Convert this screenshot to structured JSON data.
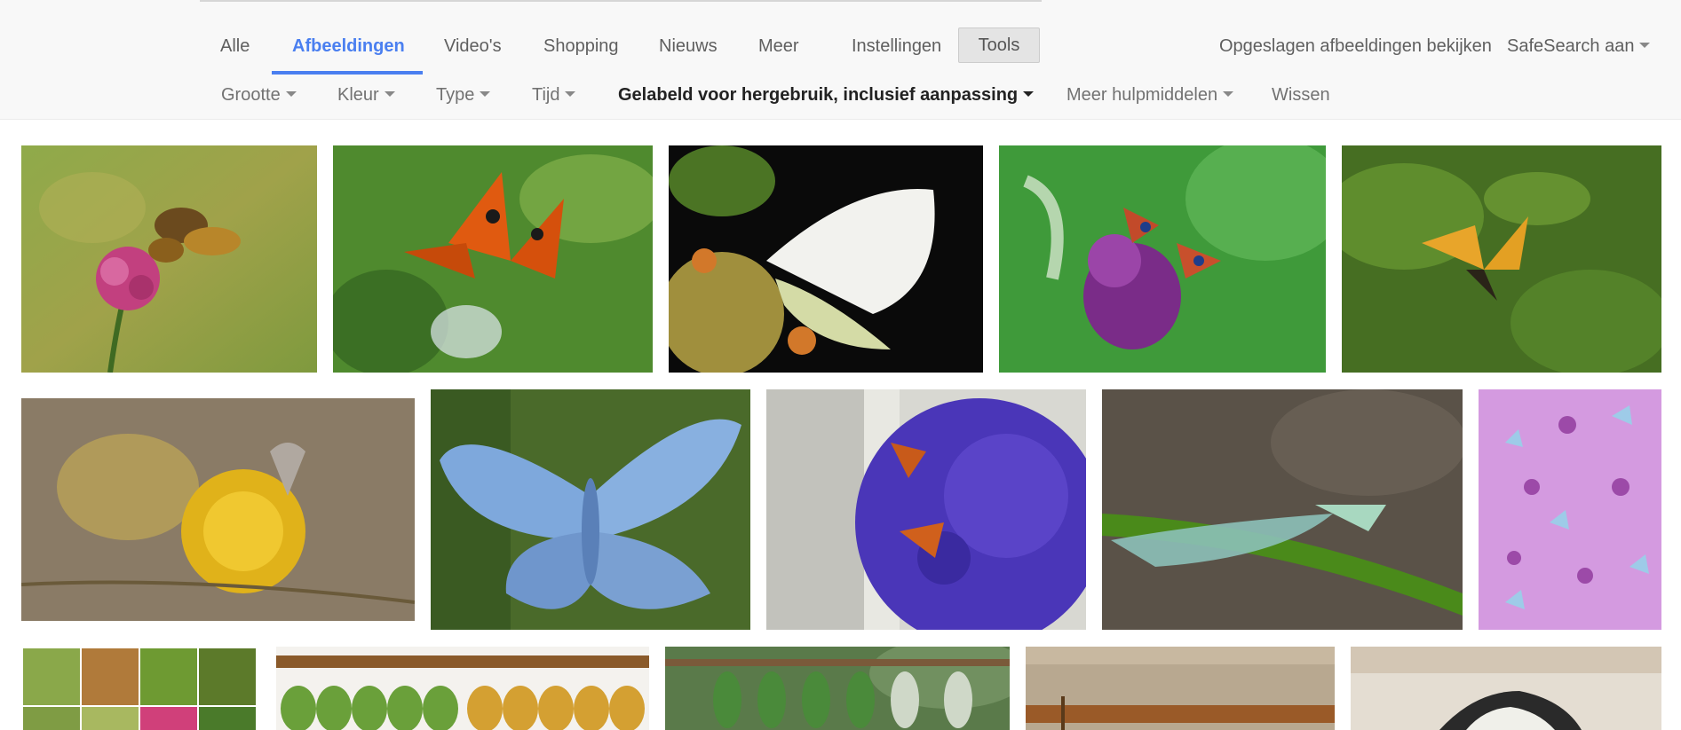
{
  "tabs": [
    {
      "label": "Alle"
    },
    {
      "label": "Afbeeldingen"
    },
    {
      "label": "Video's"
    },
    {
      "label": "Shopping"
    },
    {
      "label": "Nieuws"
    },
    {
      "label": "Meer"
    }
  ],
  "settings_label": "Instellingen",
  "tools_label": "Tools",
  "saved_images_label": "Opgeslagen afbeeldingen bekijken",
  "safesearch_label": "SafeSearch aan",
  "filters": [
    {
      "label": "Grootte"
    },
    {
      "label": "Kleur"
    },
    {
      "label": "Type"
    },
    {
      "label": "Tijd"
    },
    {
      "label": "Gelabeld voor hergebruik, inclusief aanpassing"
    },
    {
      "label": "Meer hulpmiddelen"
    }
  ],
  "clear_label": "Wissen",
  "colors": {
    "accent": "#4a7ff0",
    "header_bg": "#f8f8f8"
  },
  "images": [
    {
      "subject": "skipper butterfly on pink clover"
    },
    {
      "subject": "orange tortoiseshell butterfly"
    },
    {
      "subject": "white cabbage butterfly"
    },
    {
      "subject": "peacock butterflies on buddleja"
    },
    {
      "subject": "swallowtail butterfly on leaves"
    },
    {
      "subject": "blue butterfly on yellow thistle"
    },
    {
      "subject": "blue butterfly close-up"
    },
    {
      "subject": "tortoiseshell on purple lobelia"
    },
    {
      "subject": "green lacewing on grass blade"
    },
    {
      "subject": "pink butterfly pattern"
    },
    {
      "subject": "butterfly collage"
    },
    {
      "subject": "green and golden chrysalises"
    },
    {
      "subject": "hanging chrysalises"
    },
    {
      "subject": "chrysalis on wooden stick"
    },
    {
      "subject": "black and white butterfly"
    }
  ]
}
